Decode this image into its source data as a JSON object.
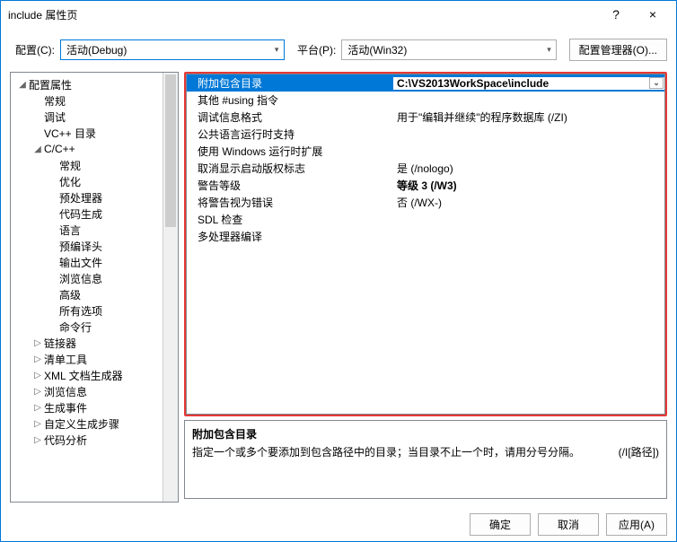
{
  "window": {
    "title": "include 属性页",
    "help": "?",
    "close": "×"
  },
  "toolbar": {
    "config_label": "配置(C):",
    "config_value": "活动(Debug)",
    "platform_label": "平台(P):",
    "platform_value": "活动(Win32)",
    "manager_btn": "配置管理器(O)..."
  },
  "tree": {
    "items": [
      {
        "label": "配置属性",
        "depth": 0,
        "exp": "◢"
      },
      {
        "label": "常规",
        "depth": 1,
        "exp": ""
      },
      {
        "label": "调试",
        "depth": 1,
        "exp": ""
      },
      {
        "label": "VC++ 目录",
        "depth": 1,
        "exp": ""
      },
      {
        "label": "C/C++",
        "depth": 1,
        "exp": "◢"
      },
      {
        "label": "常规",
        "depth": 2,
        "exp": ""
      },
      {
        "label": "优化",
        "depth": 2,
        "exp": ""
      },
      {
        "label": "预处理器",
        "depth": 2,
        "exp": ""
      },
      {
        "label": "代码生成",
        "depth": 2,
        "exp": ""
      },
      {
        "label": "语言",
        "depth": 2,
        "exp": ""
      },
      {
        "label": "预编译头",
        "depth": 2,
        "exp": ""
      },
      {
        "label": "输出文件",
        "depth": 2,
        "exp": ""
      },
      {
        "label": "浏览信息",
        "depth": 2,
        "exp": ""
      },
      {
        "label": "高级",
        "depth": 2,
        "exp": ""
      },
      {
        "label": "所有选项",
        "depth": 2,
        "exp": ""
      },
      {
        "label": "命令行",
        "depth": 2,
        "exp": ""
      },
      {
        "label": "链接器",
        "depth": 1,
        "exp": "▷"
      },
      {
        "label": "清单工具",
        "depth": 1,
        "exp": "▷"
      },
      {
        "label": "XML 文档生成器",
        "depth": 1,
        "exp": "▷"
      },
      {
        "label": "浏览信息",
        "depth": 1,
        "exp": "▷"
      },
      {
        "label": "生成事件",
        "depth": 1,
        "exp": "▷"
      },
      {
        "label": "自定义生成步骤",
        "depth": 1,
        "exp": "▷"
      },
      {
        "label": "代码分析",
        "depth": 1,
        "exp": "▷"
      }
    ]
  },
  "grid": {
    "rows": [
      {
        "k": "附加包含目录",
        "v": "C:\\VS2013WorkSpace\\include",
        "sel": true
      },
      {
        "k": "其他 #using 指令",
        "v": ""
      },
      {
        "k": "调试信息格式",
        "v": "用于\"编辑并继续\"的程序数据库 (/ZI)"
      },
      {
        "k": "公共语言运行时支持",
        "v": ""
      },
      {
        "k": "使用 Windows 运行时扩展",
        "v": ""
      },
      {
        "k": "取消显示启动版权标志",
        "v": "是 (/nologo)"
      },
      {
        "k": "警告等级",
        "v": "等级 3 (/W3)",
        "bold": true
      },
      {
        "k": "将警告视为错误",
        "v": "否 (/WX-)"
      },
      {
        "k": "SDL 检查",
        "v": ""
      },
      {
        "k": "多处理器编译",
        "v": ""
      }
    ]
  },
  "desc": {
    "title": "附加包含目录",
    "body": "指定一个或多个要添加到包含路径中的目录；当目录不止一个时，请用分号分隔。",
    "hint": "(/I[路径])"
  },
  "footer": {
    "ok": "确定",
    "cancel": "取消",
    "apply": "应用(A)"
  }
}
